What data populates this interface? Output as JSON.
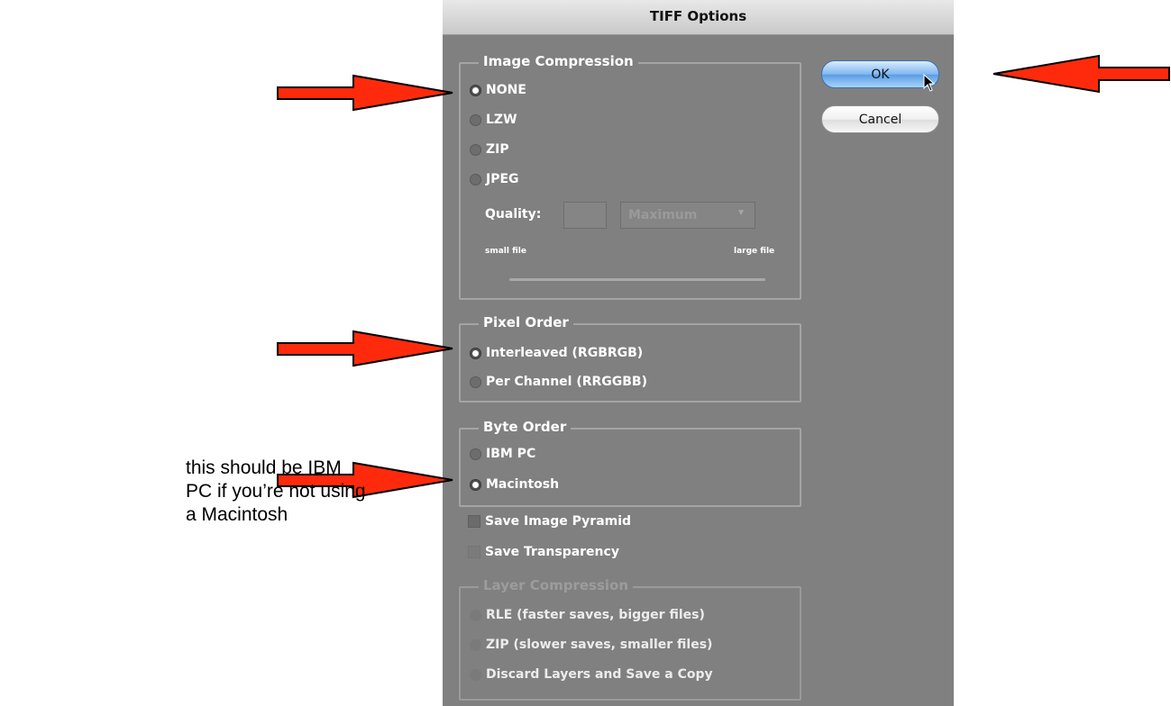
{
  "dialog": {
    "title": "TIFF Options",
    "buttons": {
      "ok": "OK",
      "cancel": "Cancel"
    }
  },
  "image_compression": {
    "legend": "Image Compression",
    "options": [
      "NONE",
      "LZW",
      "ZIP",
      "JPEG"
    ],
    "selected": "NONE",
    "quality_label": "Quality:",
    "quality_value": "",
    "quality_preset": "Maximum",
    "small_file": "small file",
    "large_file": "large file"
  },
  "pixel_order": {
    "legend": "Pixel Order",
    "options": [
      "Interleaved (RGBRGB)",
      "Per Channel (RRGGBB)"
    ],
    "selected": "Interleaved (RGBRGB)"
  },
  "byte_order": {
    "legend": "Byte Order",
    "options": [
      "IBM PC",
      "Macintosh"
    ],
    "selected": "Macintosh"
  },
  "checkboxes": {
    "save_image_pyramid": "Save Image Pyramid",
    "save_transparency": "Save Transparency"
  },
  "layer_compression": {
    "legend": "Layer Compression",
    "options": [
      "RLE (faster saves, bigger files)",
      "ZIP (slower saves, smaller files)",
      "Discard Layers and Save a Copy"
    ]
  },
  "annotation": {
    "note": "this should be IBM PC if you’re not using a Macintosh"
  },
  "colors": {
    "arrow_fill": "#ff2a0c",
    "dialog_bg": "#808080"
  }
}
